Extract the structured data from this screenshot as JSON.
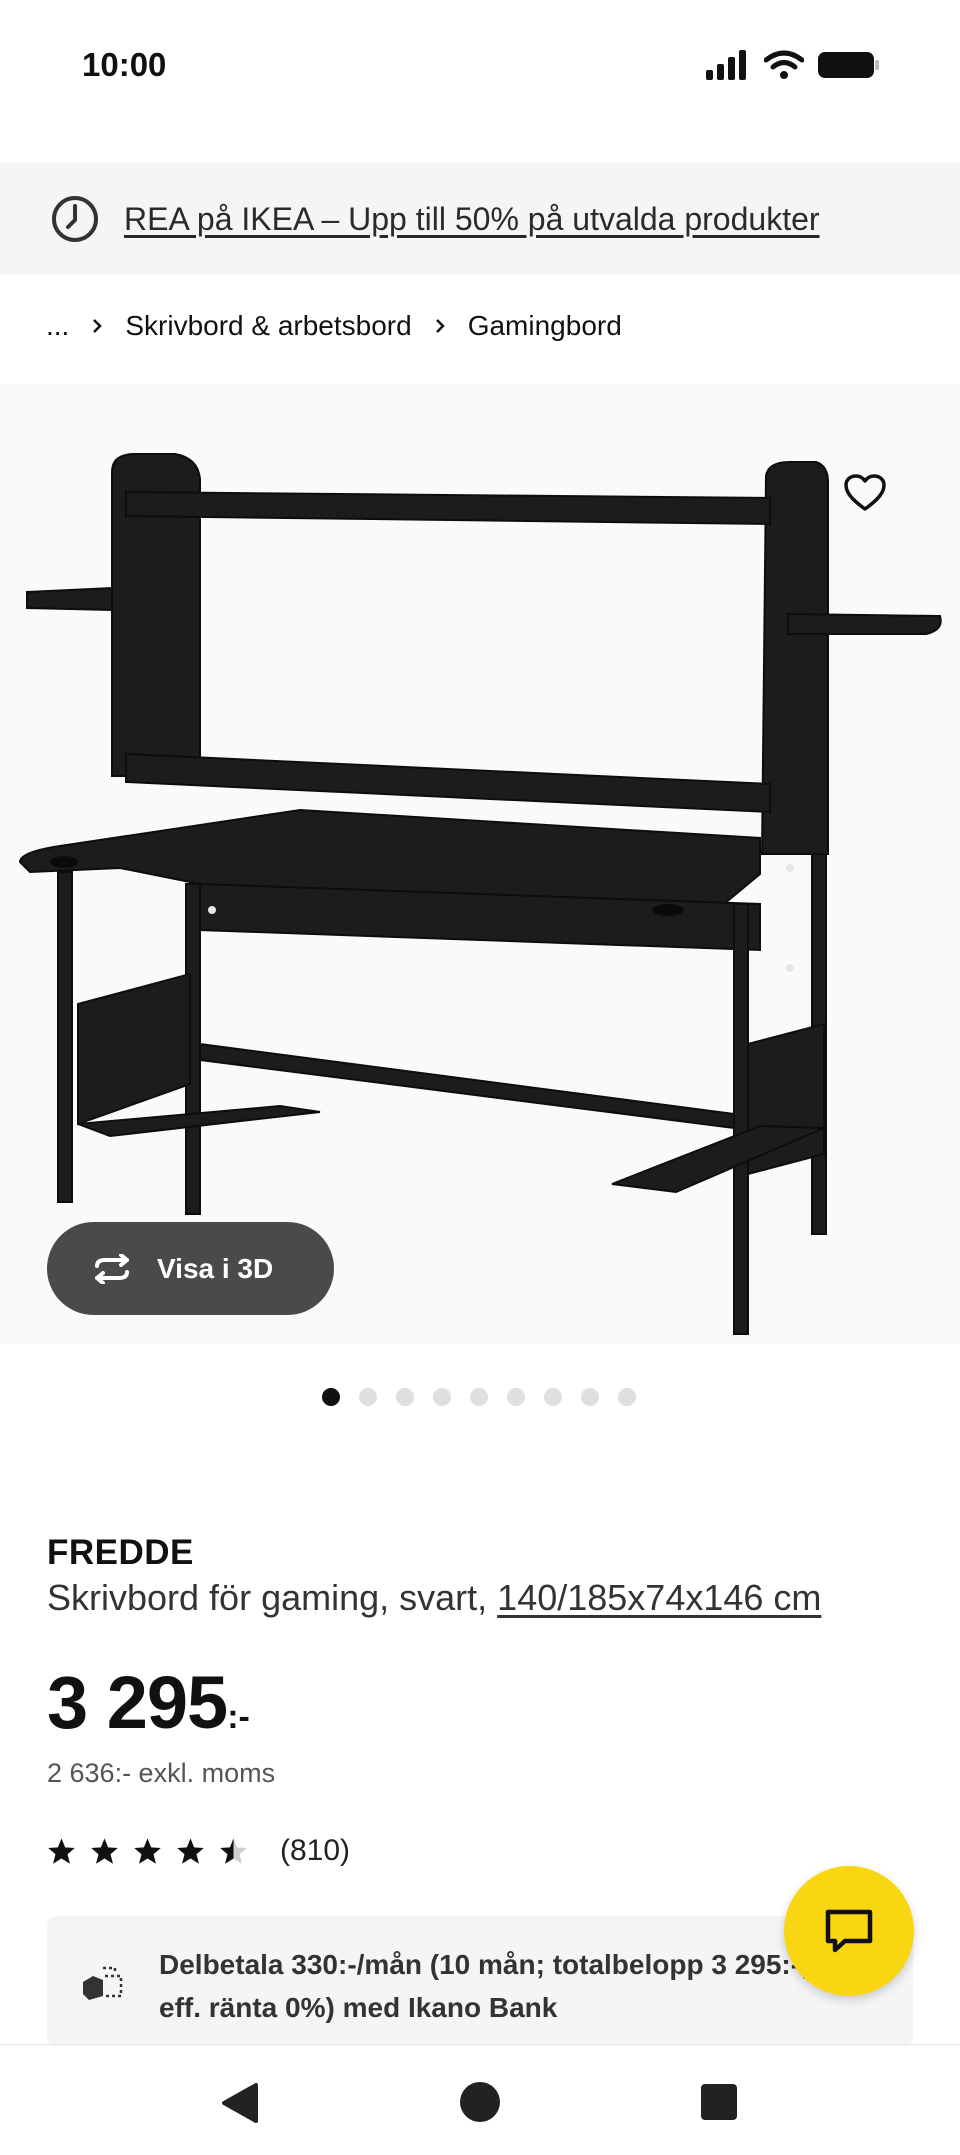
{
  "status_bar": {
    "time": "10:00"
  },
  "promo": {
    "text": "REA på IKEA – Upp till 50% på utvalda produkter"
  },
  "breadcrumb": {
    "ellipsis": "...",
    "items": [
      "Skrivbord & arbetsbord",
      "Gamingbord"
    ]
  },
  "gallery": {
    "view_3d_label": "Visa i 3D",
    "image_count": 9,
    "active_index": 0
  },
  "product": {
    "name": "FREDDE",
    "description": "Skrivbord för gaming, svart, ",
    "dimensions": "140/185x74x146 cm",
    "price": "3 295",
    "price_suffix": ":-",
    "price_excl_vat": "2 636:- exkl. moms",
    "rating": 4.5,
    "review_count": "(810)"
  },
  "finance": {
    "text": "Delbetala 330:-/mån (10 mån; totalbelopp 3 295:-; eff. ränta 0%) med Ikano Bank"
  },
  "colors": {
    "chat_button": "#f8d612",
    "promo_bg": "#f5f5f5",
    "view3d_bg": "#4a4a4a"
  }
}
